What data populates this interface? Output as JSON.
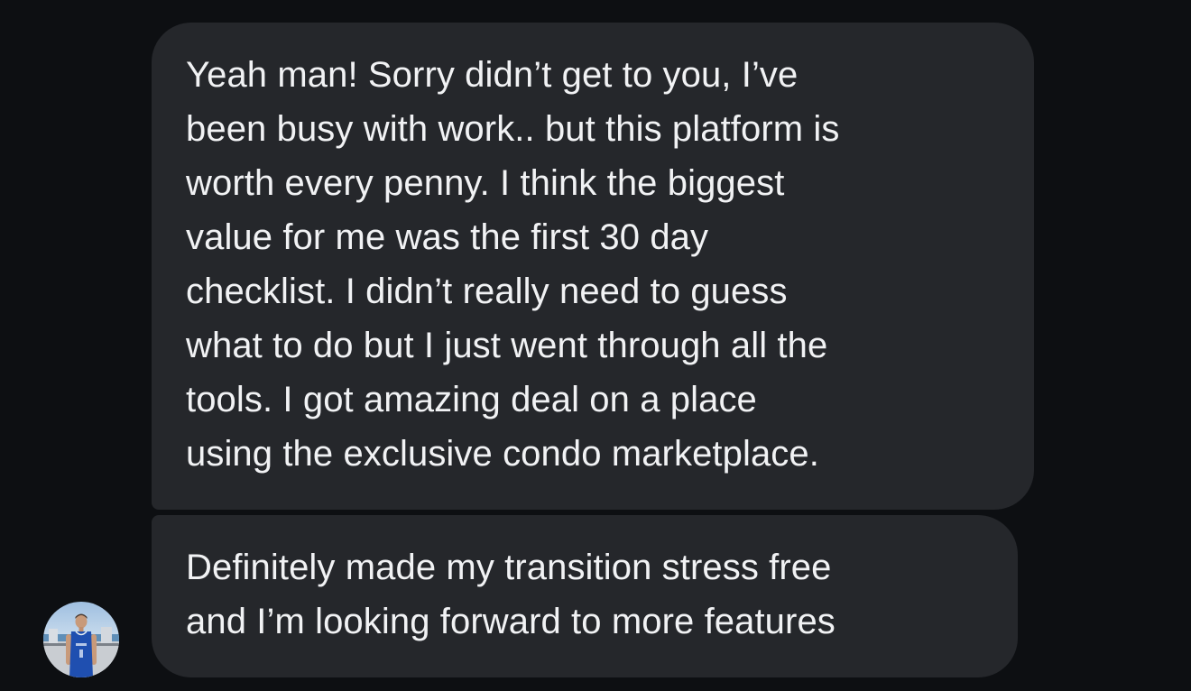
{
  "conversation": {
    "messages": [
      {
        "text": "Yeah man! Sorry didn’t get to you, I’ve\nbeen busy with work.. but this platform is\nworth every penny. I think the biggest\nvalue for me was the first 30 day\nchecklist. I didn’t really need to guess\nwhat to do but I just went through all the\ntools. I got amazing deal on a place\nusing the exclusive condo marketplace."
      },
      {
        "text": "Definitely made my transition stress free\nand I’m looking forward to more features"
      }
    ],
    "sender": {
      "avatar_icon": "user-avatar-photo"
    }
  },
  "colors": {
    "background": "#0d0f12",
    "bubble": "#25272b",
    "text": "#f1f2f4"
  }
}
